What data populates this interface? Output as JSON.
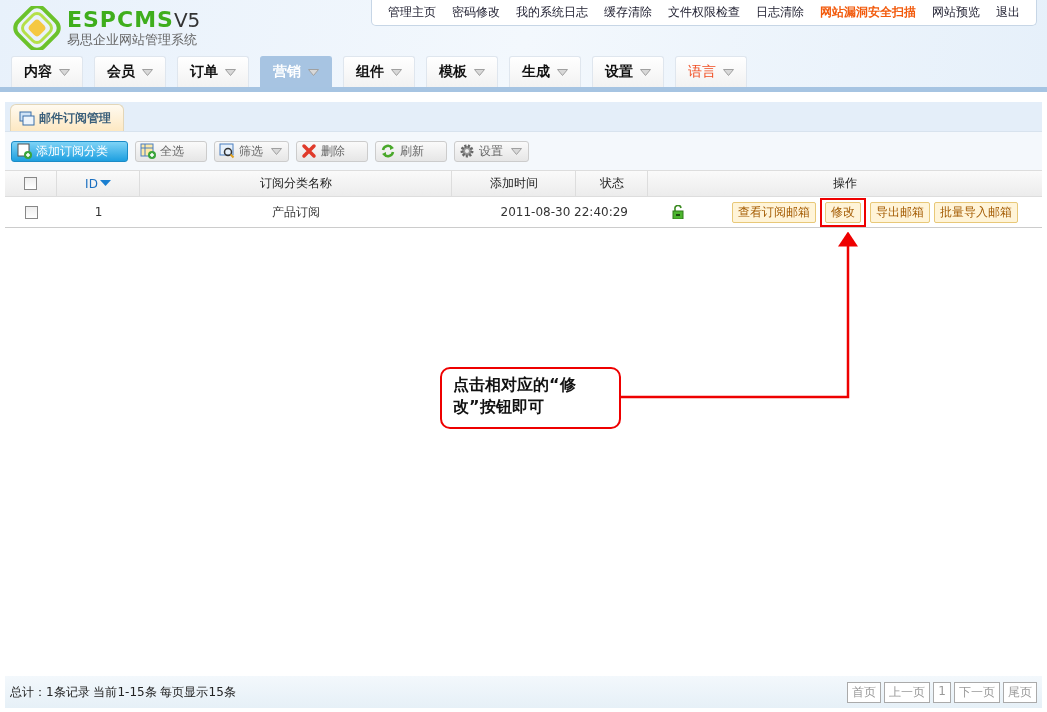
{
  "logo": {
    "brand": "ESPCMS",
    "version": "V5",
    "subtitle": "易思企业网站管理系统"
  },
  "top_links": [
    {
      "label": "管理主页",
      "kind": "normal"
    },
    {
      "label": "密码修改",
      "kind": "normal"
    },
    {
      "label": "我的系统日志",
      "kind": "normal"
    },
    {
      "label": "缓存清除",
      "kind": "normal"
    },
    {
      "label": "文件权限检查",
      "kind": "normal"
    },
    {
      "label": "日志清除",
      "kind": "normal"
    },
    {
      "label": "网站漏洞安全扫描",
      "kind": "alert"
    },
    {
      "label": "网站预览",
      "kind": "normal"
    },
    {
      "label": "退出",
      "kind": "normal"
    }
  ],
  "nav_tabs": [
    {
      "label": "内容",
      "selected": false,
      "kind": "normal"
    },
    {
      "label": "会员",
      "selected": false,
      "kind": "normal"
    },
    {
      "label": "订单",
      "selected": false,
      "kind": "normal"
    },
    {
      "label": "营销",
      "selected": true,
      "kind": "normal"
    },
    {
      "label": "组件",
      "selected": false,
      "kind": "normal"
    },
    {
      "label": "模板",
      "selected": false,
      "kind": "normal"
    },
    {
      "label": "生成",
      "selected": false,
      "kind": "normal"
    },
    {
      "label": "设置",
      "selected": false,
      "kind": "normal"
    },
    {
      "label": "语言",
      "selected": false,
      "kind": "alert"
    }
  ],
  "panel_tab": {
    "label": "邮件订阅管理"
  },
  "toolbar": [
    {
      "label": "添加订阅分类",
      "kind": "primary",
      "dropdown": false
    },
    {
      "label": "全选",
      "kind": "plain",
      "dropdown": false
    },
    {
      "label": "筛选",
      "kind": "plain",
      "dropdown": true
    },
    {
      "label": "删除",
      "kind": "plain",
      "dropdown": false
    },
    {
      "label": "刷新",
      "kind": "plain",
      "dropdown": false
    },
    {
      "label": "设置",
      "kind": "plain",
      "dropdown": true
    }
  ],
  "table": {
    "select_all": {
      "checked": false
    },
    "columns": [
      {
        "label": "ID",
        "sorted": true
      },
      {
        "label": "订阅分类名称",
        "sorted": false
      },
      {
        "label": "添加时间",
        "sorted": false
      },
      {
        "label": "状态",
        "sorted": false
      },
      {
        "label": "操作",
        "sorted": false
      }
    ],
    "rows": [
      {
        "checked": false,
        "id": "1",
        "name": "产品订阅",
        "added": "2011-08-30 22:40:29",
        "unlocked": true,
        "actions": [
          {
            "label": "查看订阅邮箱",
            "highlighted": false
          },
          {
            "label": "修改",
            "highlighted": true
          },
          {
            "label": "导出邮箱",
            "highlighted": false
          },
          {
            "label": "批量导入邮箱",
            "highlighted": false
          }
        ]
      }
    ]
  },
  "callout": {
    "text": "点击相对应的“修改”按钮即可"
  },
  "footer": {
    "summary": "总计：1条记录 当前1-15条 每页显示15条",
    "pager": [
      "首页",
      "上一页",
      "1",
      "下一页",
      "尾页"
    ]
  }
}
